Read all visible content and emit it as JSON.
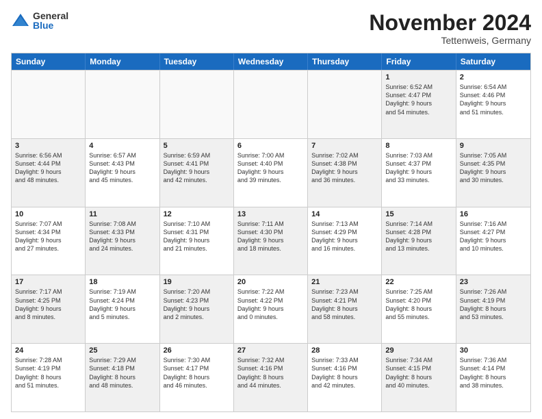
{
  "logo": {
    "general": "General",
    "blue": "Blue"
  },
  "title": "November 2024",
  "location": "Tettenweis, Germany",
  "header_days": [
    "Sunday",
    "Monday",
    "Tuesday",
    "Wednesday",
    "Thursday",
    "Friday",
    "Saturday"
  ],
  "rows": [
    [
      {
        "day": "",
        "lines": [],
        "empty": true
      },
      {
        "day": "",
        "lines": [],
        "empty": true
      },
      {
        "day": "",
        "lines": [],
        "empty": true
      },
      {
        "day": "",
        "lines": [],
        "empty": true
      },
      {
        "day": "",
        "lines": [],
        "empty": true
      },
      {
        "day": "1",
        "lines": [
          "Sunrise: 6:52 AM",
          "Sunset: 4:47 PM",
          "Daylight: 9 hours",
          "and 54 minutes."
        ],
        "shaded": true
      },
      {
        "day": "2",
        "lines": [
          "Sunrise: 6:54 AM",
          "Sunset: 4:46 PM",
          "Daylight: 9 hours",
          "and 51 minutes."
        ],
        "shaded": false
      }
    ],
    [
      {
        "day": "3",
        "lines": [
          "Sunrise: 6:56 AM",
          "Sunset: 4:44 PM",
          "Daylight: 9 hours",
          "and 48 minutes."
        ],
        "shaded": true
      },
      {
        "day": "4",
        "lines": [
          "Sunrise: 6:57 AM",
          "Sunset: 4:43 PM",
          "Daylight: 9 hours",
          "and 45 minutes."
        ],
        "shaded": false
      },
      {
        "day": "5",
        "lines": [
          "Sunrise: 6:59 AM",
          "Sunset: 4:41 PM",
          "Daylight: 9 hours",
          "and 42 minutes."
        ],
        "shaded": true
      },
      {
        "day": "6",
        "lines": [
          "Sunrise: 7:00 AM",
          "Sunset: 4:40 PM",
          "Daylight: 9 hours",
          "and 39 minutes."
        ],
        "shaded": false
      },
      {
        "day": "7",
        "lines": [
          "Sunrise: 7:02 AM",
          "Sunset: 4:38 PM",
          "Daylight: 9 hours",
          "and 36 minutes."
        ],
        "shaded": true
      },
      {
        "day": "8",
        "lines": [
          "Sunrise: 7:03 AM",
          "Sunset: 4:37 PM",
          "Daylight: 9 hours",
          "and 33 minutes."
        ],
        "shaded": false
      },
      {
        "day": "9",
        "lines": [
          "Sunrise: 7:05 AM",
          "Sunset: 4:35 PM",
          "Daylight: 9 hours",
          "and 30 minutes."
        ],
        "shaded": true
      }
    ],
    [
      {
        "day": "10",
        "lines": [
          "Sunrise: 7:07 AM",
          "Sunset: 4:34 PM",
          "Daylight: 9 hours",
          "and 27 minutes."
        ],
        "shaded": false
      },
      {
        "day": "11",
        "lines": [
          "Sunrise: 7:08 AM",
          "Sunset: 4:33 PM",
          "Daylight: 9 hours",
          "and 24 minutes."
        ],
        "shaded": true
      },
      {
        "day": "12",
        "lines": [
          "Sunrise: 7:10 AM",
          "Sunset: 4:31 PM",
          "Daylight: 9 hours",
          "and 21 minutes."
        ],
        "shaded": false
      },
      {
        "day": "13",
        "lines": [
          "Sunrise: 7:11 AM",
          "Sunset: 4:30 PM",
          "Daylight: 9 hours",
          "and 18 minutes."
        ],
        "shaded": true
      },
      {
        "day": "14",
        "lines": [
          "Sunrise: 7:13 AM",
          "Sunset: 4:29 PM",
          "Daylight: 9 hours",
          "and 16 minutes."
        ],
        "shaded": false
      },
      {
        "day": "15",
        "lines": [
          "Sunrise: 7:14 AM",
          "Sunset: 4:28 PM",
          "Daylight: 9 hours",
          "and 13 minutes."
        ],
        "shaded": true
      },
      {
        "day": "16",
        "lines": [
          "Sunrise: 7:16 AM",
          "Sunset: 4:27 PM",
          "Daylight: 9 hours",
          "and 10 minutes."
        ],
        "shaded": false
      }
    ],
    [
      {
        "day": "17",
        "lines": [
          "Sunrise: 7:17 AM",
          "Sunset: 4:25 PM",
          "Daylight: 9 hours",
          "and 8 minutes."
        ],
        "shaded": true
      },
      {
        "day": "18",
        "lines": [
          "Sunrise: 7:19 AM",
          "Sunset: 4:24 PM",
          "Daylight: 9 hours",
          "and 5 minutes."
        ],
        "shaded": false
      },
      {
        "day": "19",
        "lines": [
          "Sunrise: 7:20 AM",
          "Sunset: 4:23 PM",
          "Daylight: 9 hours",
          "and 2 minutes."
        ],
        "shaded": true
      },
      {
        "day": "20",
        "lines": [
          "Sunrise: 7:22 AM",
          "Sunset: 4:22 PM",
          "Daylight: 9 hours",
          "and 0 minutes."
        ],
        "shaded": false
      },
      {
        "day": "21",
        "lines": [
          "Sunrise: 7:23 AM",
          "Sunset: 4:21 PM",
          "Daylight: 8 hours",
          "and 58 minutes."
        ],
        "shaded": true
      },
      {
        "day": "22",
        "lines": [
          "Sunrise: 7:25 AM",
          "Sunset: 4:20 PM",
          "Daylight: 8 hours",
          "and 55 minutes."
        ],
        "shaded": false
      },
      {
        "day": "23",
        "lines": [
          "Sunrise: 7:26 AM",
          "Sunset: 4:19 PM",
          "Daylight: 8 hours",
          "and 53 minutes."
        ],
        "shaded": true
      }
    ],
    [
      {
        "day": "24",
        "lines": [
          "Sunrise: 7:28 AM",
          "Sunset: 4:19 PM",
          "Daylight: 8 hours",
          "and 51 minutes."
        ],
        "shaded": false
      },
      {
        "day": "25",
        "lines": [
          "Sunrise: 7:29 AM",
          "Sunset: 4:18 PM",
          "Daylight: 8 hours",
          "and 48 minutes."
        ],
        "shaded": true
      },
      {
        "day": "26",
        "lines": [
          "Sunrise: 7:30 AM",
          "Sunset: 4:17 PM",
          "Daylight: 8 hours",
          "and 46 minutes."
        ],
        "shaded": false
      },
      {
        "day": "27",
        "lines": [
          "Sunrise: 7:32 AM",
          "Sunset: 4:16 PM",
          "Daylight: 8 hours",
          "and 44 minutes."
        ],
        "shaded": true
      },
      {
        "day": "28",
        "lines": [
          "Sunrise: 7:33 AM",
          "Sunset: 4:16 PM",
          "Daylight: 8 hours",
          "and 42 minutes."
        ],
        "shaded": false
      },
      {
        "day": "29",
        "lines": [
          "Sunrise: 7:34 AM",
          "Sunset: 4:15 PM",
          "Daylight: 8 hours",
          "and 40 minutes."
        ],
        "shaded": true
      },
      {
        "day": "30",
        "lines": [
          "Sunrise: 7:36 AM",
          "Sunset: 4:14 PM",
          "Daylight: 8 hours",
          "and 38 minutes."
        ],
        "shaded": false
      }
    ]
  ]
}
